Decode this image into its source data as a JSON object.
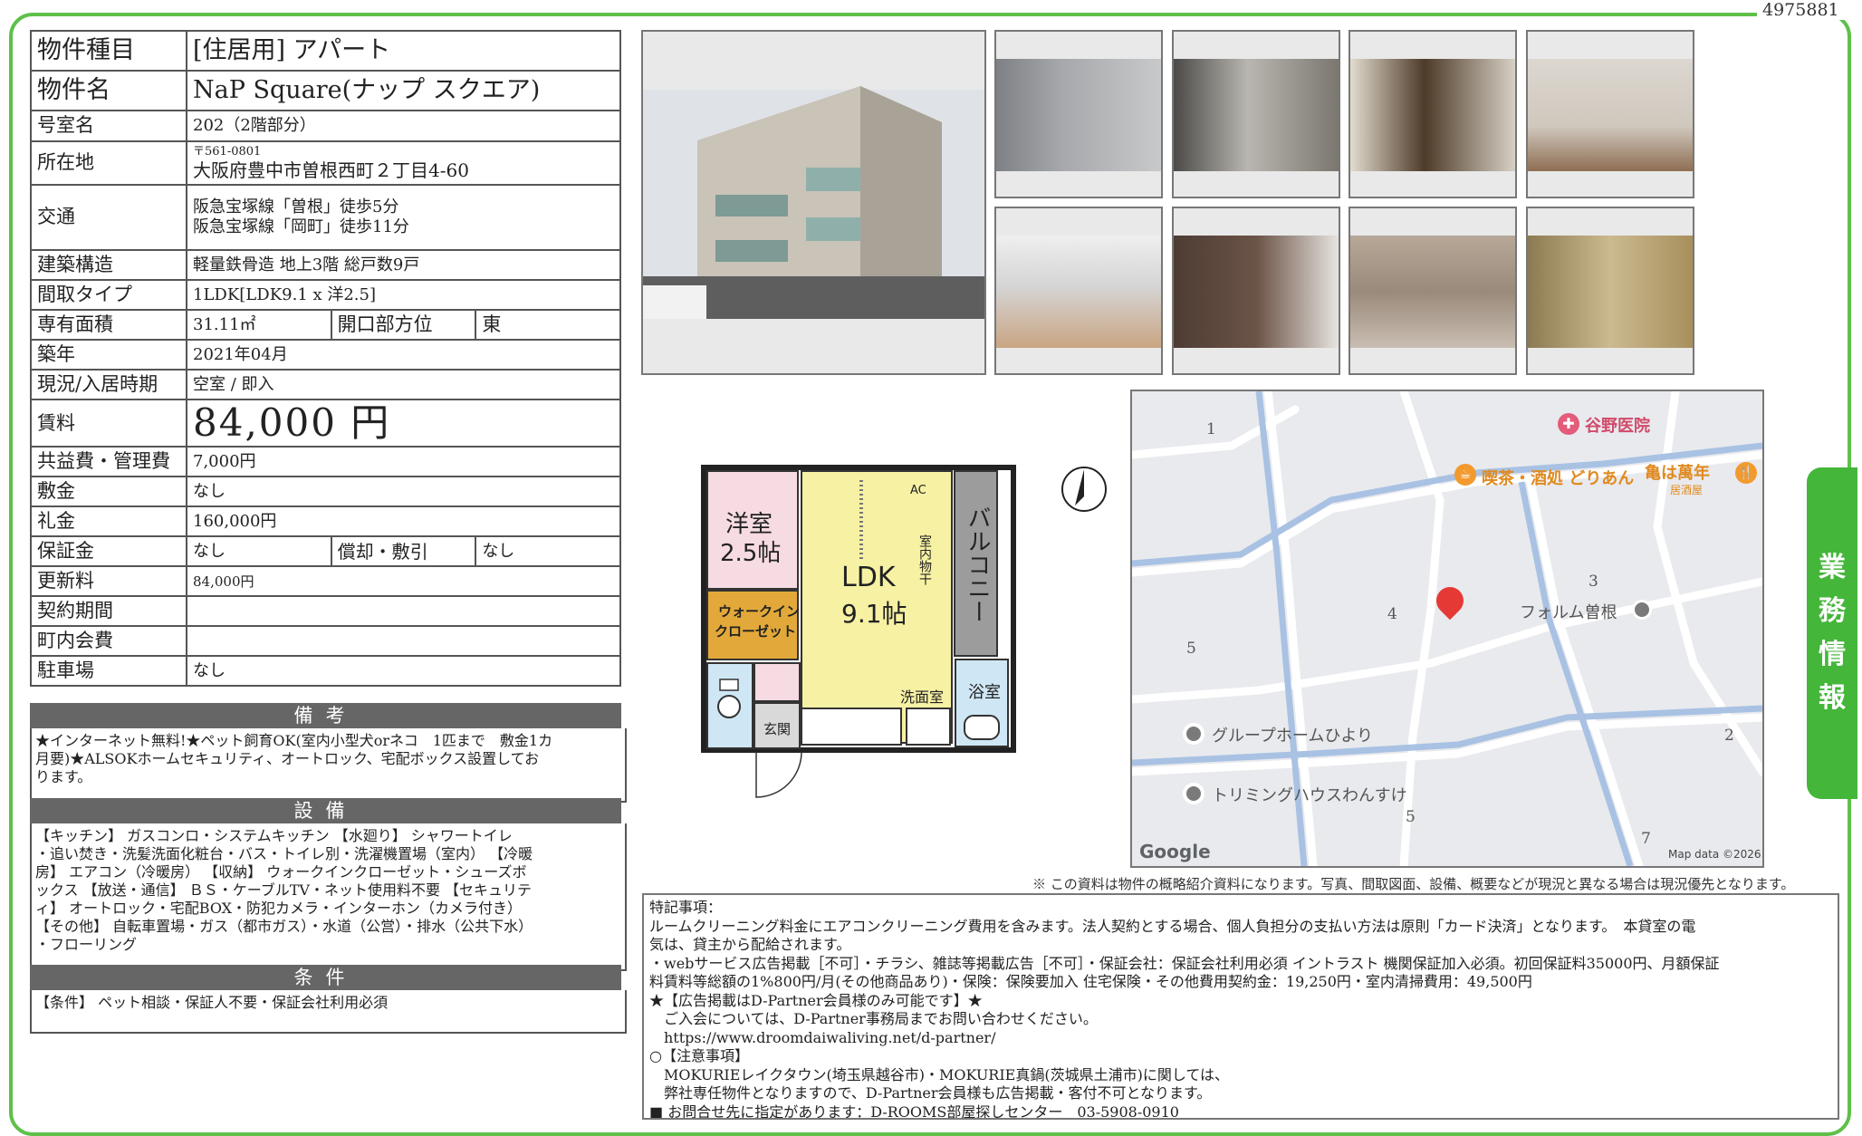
{
  "property_id": "4975881",
  "spec": {
    "type_label": "物件種目",
    "type_value": "[住居用] アパート",
    "name_label": "物件名",
    "name_value": "NaP Square(ナップ スクエア)",
    "room_label": "号室名",
    "room_value": "202（2階部分）",
    "location_label": "所在地",
    "zip": "〒561-0801",
    "address": "大阪府豊中市曽根西町２丁目4-60",
    "transport_label": "交通",
    "transport_1": "阪急宝塚線「曽根」徒歩5分",
    "transport_2": "阪急宝塚線「岡町」徒歩11分",
    "structure_label": "建築構造",
    "structure_value": "軽量鉄骨造 地上3階 総戸数9戸",
    "layout_label": "間取タイプ",
    "layout_value": "1LDK[LDK9.1 x 洋2.5]",
    "area_label": "専有面積",
    "area_value": "31.11㎡",
    "direction_label": "開口部方位",
    "direction_value": "東",
    "built_label": "築年",
    "built_value": "2021年04月",
    "status_label": "現況/入居時期",
    "status_value": "空室 / 即入",
    "rent_label": "賃料",
    "rent_value": "84,000 円",
    "fee_label": "共益費・管理費",
    "fee_value": "7,000円",
    "deposit_label": "敷金",
    "deposit_value": "なし",
    "key_money_label": "礼金",
    "key_money_value": "160,000円",
    "guarantee_label": "保証金",
    "guarantee_value": "なし",
    "amort_label": "償却・敷引",
    "amort_value": "なし",
    "renewal_label": "更新料",
    "renewal_value": "84,000円",
    "contract_label": "契約期間",
    "contract_value": "",
    "community_label": "町内会費",
    "community_value": "",
    "parking_label": "駐車場",
    "parking_value": "なし"
  },
  "remarks": {
    "heading": "備考",
    "line1": "★インターネット無料!★ペット飼育OK(室内小型犬orネコ　1匹まで　敷金1カ",
    "line2": "月要)★ALSOKホームセキュリティ、オートロック、宅配ボックス設置してお",
    "line3": "ります。"
  },
  "equipment": {
    "heading": "設備",
    "line1": "【キッチン】 ガスコンロ・システムキッチン 【水廻り】 シャワートイレ",
    "line2": "・追い焚き・洗髪洗面化粧台・バス・トイレ別・洗濯機置場（室内） 【冷暖",
    "line3": "房】 エアコン（冷暖房） 【収納】 ウォークインクローゼット・シューズボ",
    "line4": "ックス 【放送・通信】 ＢＳ・ケーブルTV・ネット使用料不要 【セキュリテ",
    "line5": "ィ】 オートロック・宅配BOX・防犯カメラ・インターホン（カメラ付き）",
    "line6": "【その他】 自転車置場・ガス（都市ガス）・水道（公営）・排水（公共下水）",
    "line7": "・フローリング"
  },
  "conditions": {
    "heading": "条件",
    "line1": "【条件】 ペット相談・保証人不要・保証会社利用必須"
  },
  "floorplan": {
    "room1_name": "洋室",
    "room1_size": "2.5帖",
    "ldk_name": "LDK",
    "ldk_size": "9.1帖",
    "closet": "ウォークイン",
    "closet2": "クローゼット",
    "balcony": "バルコニー",
    "drying": "室内物干",
    "washroom": "洗面室",
    "bath": "浴室",
    "entrance": "玄関",
    "ac": "AC"
  },
  "map": {
    "poi_clinic": "谷野医院",
    "poi_cafe": "喫茶・酒処 どりあん",
    "poi_izakaya": "亀は萬年",
    "poi_izakaya_sub": "居酒屋",
    "poi_forum": "フォルム曽根",
    "poi_group": "グループホームひより",
    "poi_trim": "トリミングハウスわんすけ",
    "block_1": "1",
    "block_2": "2",
    "block_3": "3",
    "block_4": "4",
    "block_5a": "5",
    "block_5b": "5",
    "block_7": "7",
    "google": "Google",
    "mapdata": "Map data ©2026"
  },
  "disclaimer": "※ この資料は物件の概略紹介資料になります。写真、間取図面、設備、概要などが現況と異なる場合は現況優先となります。",
  "special": {
    "l1": "特記事項：",
    "l2": "ルームクリーニング料金にエアコンクリーニング費用を含みます。法人契約とする場合、個人負担分の支払い方法は原則「カード決済」となります。　本貸室の電",
    "l3": "気は、貸主から配給されます。",
    "l4": "・webサービス広告掲載［不可］・チラシ、雑誌等掲載広告［不可］・保証会社：保証会社利用必須 イントラスト 機関保証加入必須。初回保証料35000円、月額保証",
    "l5": "料賃料等総額の1%800円/月(その他商品あり)・保険：保険要加入 住宅保険・その他費用契約金：19,250円・室内清掃費用：49,500円",
    "l6": "★【広告掲載はD-Partner会員様のみ可能です】★",
    "l7": "　ご入会については、D-Partner事務局までお問い合わせください。",
    "l8": "　https://www.droomdaiwaliving.net/d-partner/",
    "l9": "○【注意事項】",
    "l10": "　MOKURIEレイクタウン(埼玉県越谷市)・MOKURIE真鍋(茨城県土浦市)に関しては、",
    "l11": "　弊社専任物件となりますので、D-Partner会員様も広告掲載・客付不可となります。",
    "l12": "■ お問合せ先に指定があります：D-ROOMS部屋探しセンター　03-5908-0910"
  },
  "side_tab": [
    "業",
    "務",
    "情",
    "報"
  ]
}
